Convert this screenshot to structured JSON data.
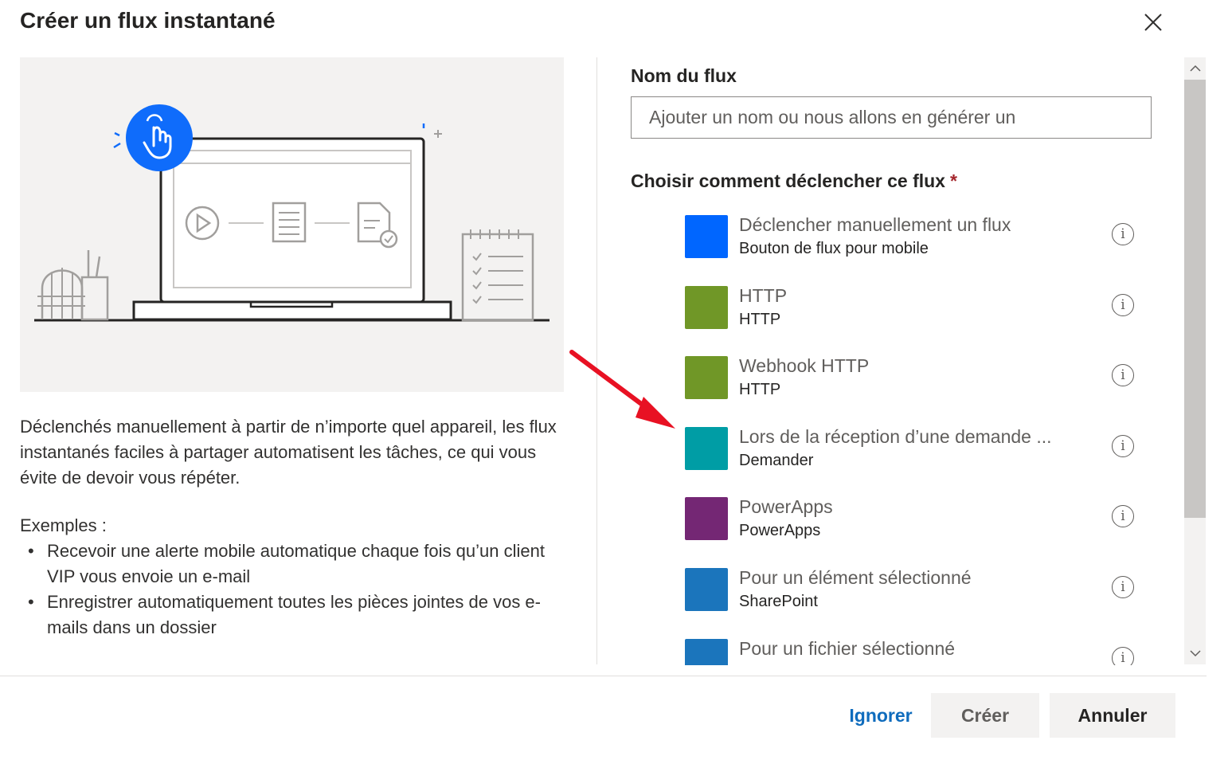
{
  "dialog": {
    "title": "Créer un flux instantané"
  },
  "left": {
    "description": "Déclenchés manuellement à partir de n’importe quel appareil, les flux instantanés faciles à partager automatisent les tâches, ce qui vous évite de devoir vous répéter.",
    "examples_title": "Exemples :",
    "examples": [
      "Recevoir une alerte mobile automatique chaque fois qu’un client VIP vous envoie un e-mail",
      "Enregistrer automatiquement toutes les pièces jointes de vos e-mails dans un dossier"
    ]
  },
  "form": {
    "name_label": "Nom du flux",
    "name_placeholder": "Ajouter un nom ou nous allons en générer un",
    "name_value": "",
    "trigger_label": "Choisir comment déclencher ce flux",
    "required_marker": "*",
    "triggers": [
      {
        "name": "Déclencher manuellement un flux",
        "connector": "Bouton de flux pour mobile",
        "color": "#0066ff",
        "icon": "info-icon"
      },
      {
        "name": "HTTP",
        "connector": "HTTP",
        "color": "#709727",
        "icon": "info-icon"
      },
      {
        "name": "Webhook HTTP",
        "connector": "HTTP",
        "color": "#709727",
        "icon": "info-icon"
      },
      {
        "name": "Lors de la réception d’une demande ...",
        "connector": "Demander",
        "color": "#009da5",
        "icon": "info-icon"
      },
      {
        "name": "PowerApps",
        "connector": "PowerApps",
        "color": "#742774",
        "icon": "info-icon"
      },
      {
        "name": "Pour un élément sélectionné",
        "connector": "SharePoint",
        "color": "#1b75bc",
        "icon": "info-icon"
      },
      {
        "name": "Pour un fichier sélectionné",
        "connector": "",
        "color": "#1b75bc",
        "icon": "info-icon"
      }
    ],
    "info_glyph": "i"
  },
  "footer": {
    "ignore_label": "Ignorer",
    "create_label": "Créer",
    "cancel_label": "Annuler"
  },
  "colors": {
    "accent_blue": "#0f6cbd",
    "illustration_blue": "#0f6cfb",
    "annotation_red": "#e81123"
  }
}
